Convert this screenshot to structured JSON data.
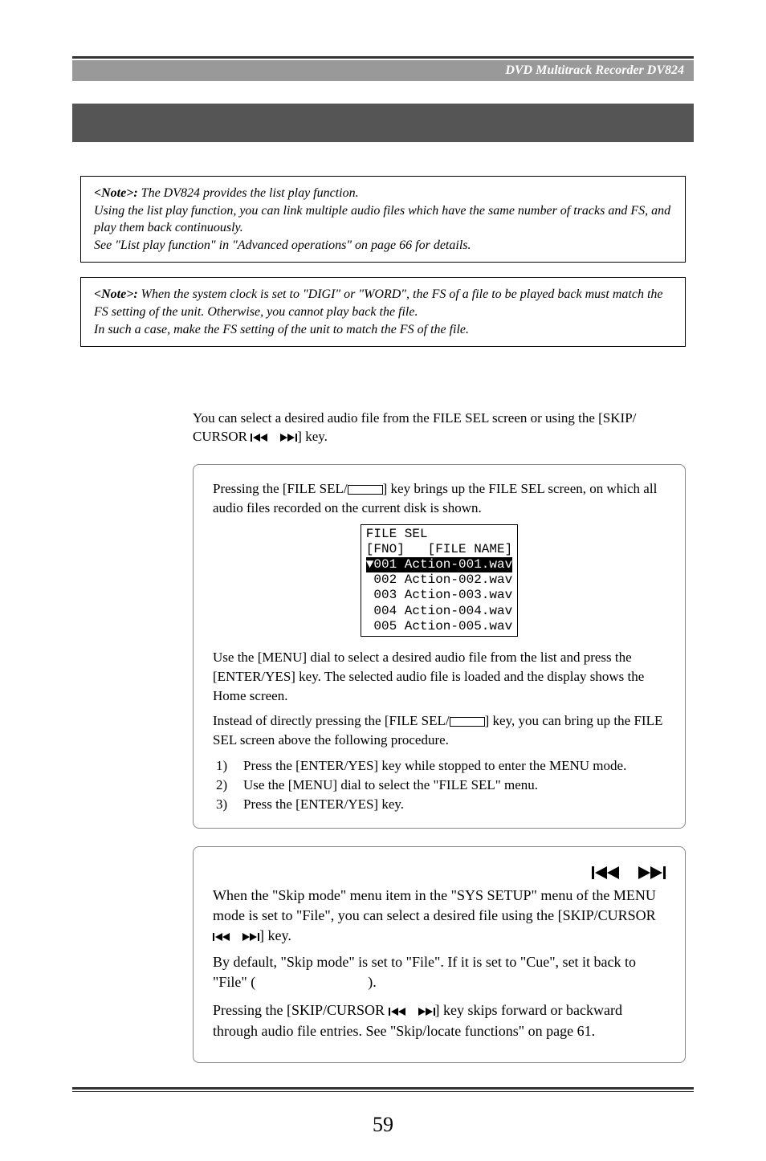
{
  "header": {
    "title": "DVD Multitrack Recorder DV824"
  },
  "note1": {
    "label": "<Note>: ",
    "body": "The DV824 provides the list play function.\nUsing the list play function, you can link multiple audio files which have the same number of tracks and FS, and play them back continuously.\nSee \"List play function\" in \"Advanced operations\" on page 66 for details."
  },
  "note2": {
    "label": "<Note>: ",
    "body": "When the system clock is set to \"DIGI\" or \"WORD\", the FS of a file to be played back must match the FS setting of the unit. Otherwise, you cannot play back the file.\nIn such a case, make the FS setting of the unit to match the FS of the file."
  },
  "intro": {
    "line1a": "You can select a desired audio file from the FILE SEL screen or using the [SKIP/",
    "line1b": "CURSOR ",
    "line1c": "] key."
  },
  "box1": {
    "p1a": "Pressing the [FILE SEL/",
    "p1b": "] key brings up the FILE SEL screen, on which all audio files recorded on the current disk is shown.",
    "lcd": {
      "l1": "FILE SEL",
      "l2": "[FNO]   [FILE NAME]",
      "l3": "▼001 Action-001.wav",
      "l4": " 002 Action-002.wav",
      "l5": " 003 Action-003.wav",
      "l6": " 004 Action-004.wav",
      "l7": " 005 Action-005.wav"
    },
    "p2": "Use the [MENU] dial to select a desired audio file from the list and press the [ENTER/YES] key. The selected audio file is loaded and the display shows the Home screen.",
    "p3a": "Instead of directly pressing the [FILE SEL/",
    "p3b": "] key, you can bring up the FILE SEL screen above the following procedure.",
    "steps": {
      "s1n": "1)",
      "s1": "Press the [ENTER/YES] key while stopped to enter the MENU mode.",
      "s2n": "2)",
      "s2": "Use the [MENU] dial to select the \"FILE SEL\" menu.",
      "s3n": "3)",
      "s3": "Press the [ENTER/YES] key."
    }
  },
  "box2": {
    "p1a": "When the \"Skip mode\" menu item in the \"SYS SETUP\" menu of the MENU mode is set to \"File\", you can select a desired file using the [SKIP/CURSOR ",
    "p1b": "] key.",
    "p2a": "By default, \"Skip mode\" is set to \"File\". If it is set to \"Cue\", set it back to \"File\" (",
    "p2b": ").",
    "p3a": "Pressing the [SKIP/CURSOR ",
    "p3b": "] key skips forward or backward through audio file entries. See \"Skip/locate functions\" on page 61."
  },
  "pagenum": "59"
}
